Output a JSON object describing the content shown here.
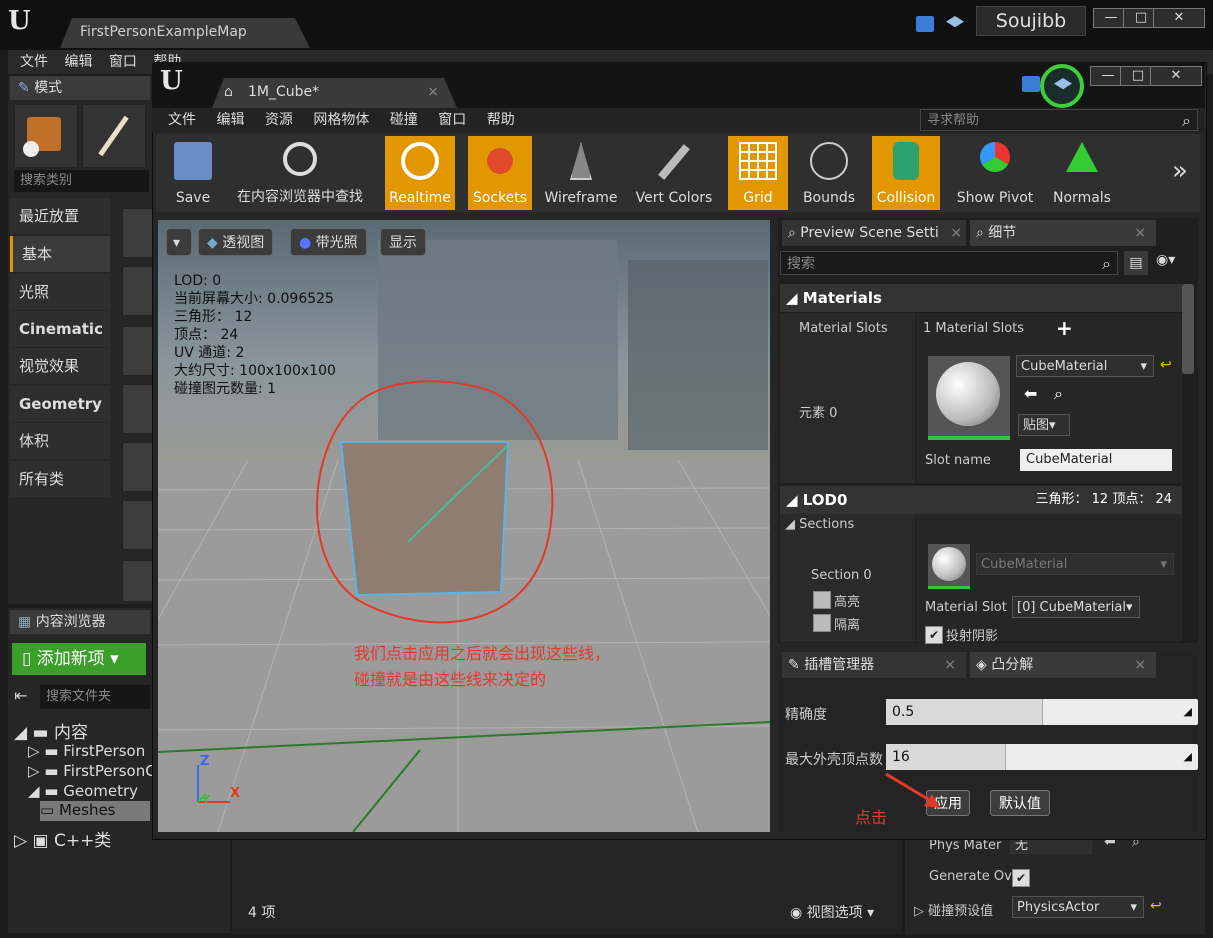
{
  "main_window": {
    "tab_title": "FirstPersonExampleMap",
    "user": "Soujibb",
    "menu": [
      "文件",
      "编辑",
      "窗口",
      "帮助"
    ],
    "window_buttons": [
      "—",
      "□",
      "✕"
    ]
  },
  "modes": {
    "title": "模式",
    "search_placeholder": "搜索类别",
    "categories": [
      "最近放置",
      "基本",
      "光照",
      "Cinematic",
      "视觉效果",
      "Geometry",
      "体积",
      "所有类"
    ]
  },
  "content_browser": {
    "title": "内容浏览器",
    "add_new": "添加新项",
    "folder_search_placeholder": "搜索文件夹",
    "tree": [
      "内容",
      "FirstPerson",
      "FirstPersonC",
      "Geometry",
      "Meshes",
      "C++类"
    ],
    "item_count": "4 项",
    "view_options": "视图选项"
  },
  "lower_details": {
    "phys_material_label": "Phys Mater",
    "phys_material_value": "无",
    "generate_overlap_label": "Generate Ov",
    "collision_preset_label": "碰撞预设值",
    "collision_preset_value": "PhysicsActor"
  },
  "mesh_editor": {
    "tab_title": "1M_Cube*",
    "menu": [
      "文件",
      "编辑",
      "资源",
      "网格物体",
      "碰撞",
      "窗口",
      "帮助"
    ],
    "help_search_placeholder": "寻求帮助",
    "toolbar": [
      "Save",
      "在内容浏览器中查找",
      "Realtime",
      "Sockets",
      "Wireframe",
      "Vert Colors",
      "Grid",
      "Bounds",
      "Collision",
      "Show Pivot",
      "Normals"
    ],
    "toolbar_more": "»"
  },
  "viewport": {
    "buttons": [
      "透视图",
      "带光照",
      "显示"
    ],
    "stats": [
      "LOD: 0",
      "当前屏幕大小: 0.096525",
      "三角形： 12",
      "顶点： 24",
      "UV 通道: 2",
      "大约尺寸: 100x100x100",
      "碰撞图元数量: 1"
    ],
    "note_line1": "我们点击应用之后就会出现这些线，",
    "note_line2": "碰撞就是由这些线来决定的",
    "axis_x": "X",
    "axis_y": "Y",
    "axis_z": "Z"
  },
  "details_panel": {
    "tabs": [
      "Preview Scene Setti",
      "细节"
    ],
    "search_placeholder": "搜索",
    "materials_header": "Materials",
    "material_slots_label": "Material Slots",
    "material_slots_value": "1 Material Slots",
    "element_label": "元素 0",
    "material_name": "CubeMaterial",
    "texture_button": "贴图",
    "slot_name_label": "Slot name",
    "slot_name_value": "CubeMaterial",
    "lod_header": "LOD0",
    "lod_stats": "三角形： 12   顶点： 24",
    "sections_label": "Sections",
    "section_label": "Section 0",
    "highlight_label": "高亮",
    "isolate_label": "隔离",
    "section_material": "CubeMaterial",
    "material_slot_label": "Material Slot",
    "material_slot_value": "[0] CubeMaterial",
    "cast_shadow_label": "投射阴影"
  },
  "convex_panel": {
    "tabs": [
      "插槽管理器",
      "凸分解"
    ],
    "accuracy_label": "精确度",
    "accuracy_value": "0.5",
    "max_hull_label": "最大外壳顶点数",
    "max_hull_value": "16",
    "apply_button": "应用",
    "defaults_button": "默认值",
    "click_note": "点击"
  },
  "colors": {
    "accent_orange": "#e29600",
    "add_green": "#3aa02a",
    "annotation_red": "#e23a2a"
  }
}
